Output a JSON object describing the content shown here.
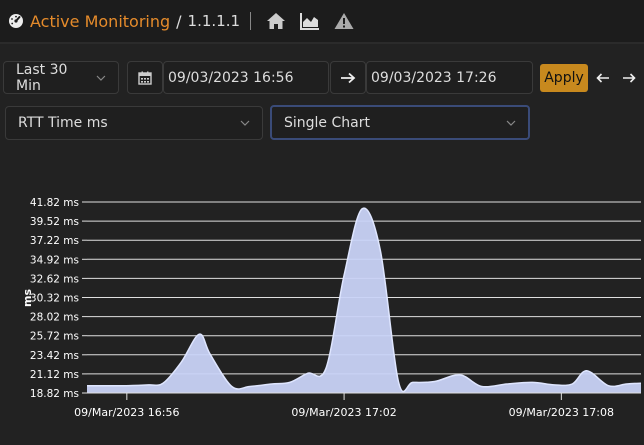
{
  "header": {
    "brand": "Active Monitoring",
    "separator": "/",
    "host": "1.1.1.1",
    "icons": [
      "home-icon",
      "area-chart-icon",
      "warning-icon"
    ]
  },
  "toolbar": {
    "range_select": "Last 30 Min",
    "start_date": "09/03/2023 16:56",
    "end_date": "09/03/2023 17:26",
    "apply_label": "Apply",
    "metric_select": "RTT Time ms",
    "view_select": "Single Chart"
  },
  "colors": {
    "brand": "#e58b2b",
    "apply": "#c8891e",
    "series_fill": "#c9d3f7",
    "series_line": "#dfe6ff"
  },
  "chart_data": {
    "type": "area",
    "ylabel": "ms",
    "ylim": [
      18.82,
      41.82
    ],
    "y_ticks": [
      "18.82 ms",
      "21.12 ms",
      "23.42 ms",
      "25.72 ms",
      "28.02 ms",
      "30.32 ms",
      "32.62 ms",
      "34.92 ms",
      "37.22 ms",
      "39.52 ms",
      "41.82 ms"
    ],
    "x_tick_labels": [
      "09/Mar/2023 16:56",
      "09/Mar/2023 17:02",
      "09/Mar/2023 17:08"
    ],
    "x_ticks_minutes": [
      0,
      6,
      12
    ],
    "x_range_minutes": [
      -1.1,
      14.2
    ],
    "grid": true,
    "series": [
      {
        "x": [
          -1.1,
          -0.6,
          0,
          0.6,
          1.0,
          1.5,
          2.0,
          2.3,
          2.9,
          3.4,
          4.0,
          4.5,
          5.0,
          5.5,
          6.0,
          6.5,
          7.0,
          7.5,
          7.9,
          8.5,
          9.2,
          9.8,
          10.5,
          11.2,
          11.8,
          12.3,
          12.7,
          13.3,
          13.8,
          14.2
        ],
        "y": [
          19.7,
          19.7,
          19.7,
          19.8,
          20.0,
          22.5,
          25.9,
          23.5,
          19.6,
          19.6,
          19.9,
          20.1,
          21.2,
          21.8,
          33.0,
          41.0,
          36.0,
          20.2,
          20.1,
          20.2,
          21.0,
          19.6,
          19.9,
          20.1,
          19.8,
          19.9,
          21.5,
          19.7,
          19.9,
          20.0
        ]
      }
    ]
  }
}
